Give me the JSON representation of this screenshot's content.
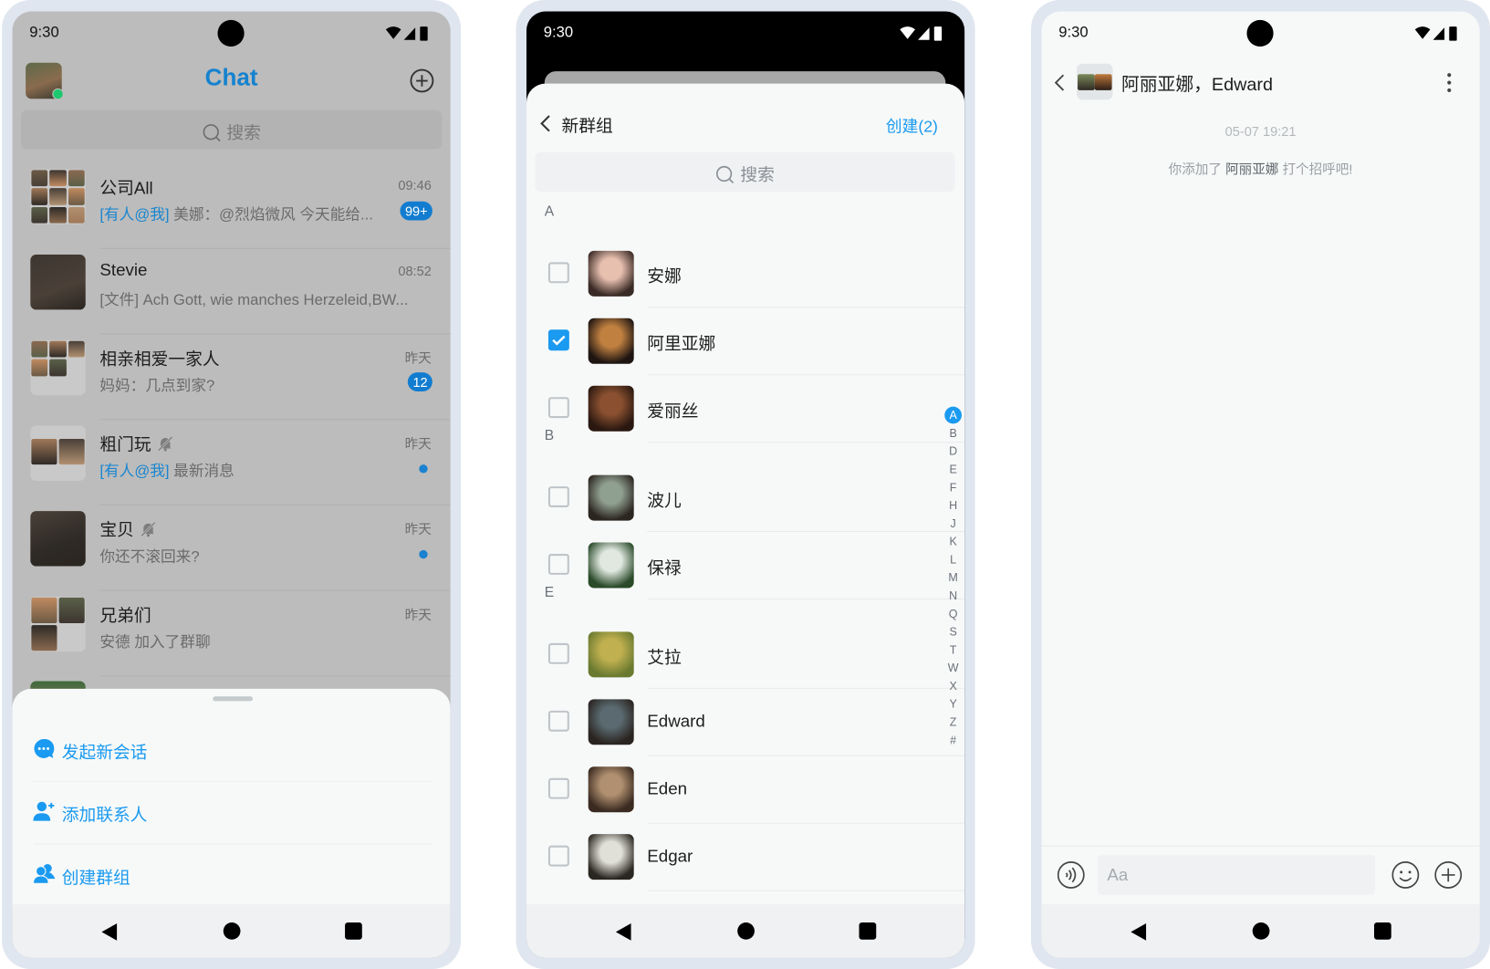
{
  "status_bar": {
    "time": "9:30"
  },
  "colors": {
    "accent": "#1a9af0",
    "title_blue": "#1582cf",
    "badge": "#127dd0",
    "online": "#1ec86e"
  },
  "chat_list": {
    "title": "Chat",
    "search_placeholder": "搜索",
    "rows": [
      {
        "name": "公司All",
        "time": "09:46",
        "mention": "[有人@我]",
        "preview": "美娜：@烈焰微风 今天能给...",
        "badge": "99+",
        "muted": false,
        "group": 9
      },
      {
        "name": "Stevie",
        "time": "08:52",
        "mention": "",
        "preview": "[文件] Ach Gott, wie manches Herzeleid,BW...",
        "badge": "",
        "muted": false,
        "group": 1
      },
      {
        "name": "相亲相爱一家人",
        "time": "昨天",
        "mention": "",
        "preview": "妈妈：几点到家?",
        "badge": "12",
        "muted": false,
        "group": 5
      },
      {
        "name": "粗门玩",
        "time": "昨天",
        "mention": "[有人@我]",
        "preview": "最新消息",
        "badge": "",
        "dot": true,
        "muted": true,
        "group": 2
      },
      {
        "name": "宝贝",
        "time": "昨天",
        "mention": "",
        "preview": "你还不滚回来?",
        "badge": "",
        "dot": true,
        "muted": true,
        "group": 1
      },
      {
        "name": "兄弟们",
        "time": "昨天",
        "mention": "",
        "preview": "安德 加入了群聊",
        "badge": "",
        "muted": false,
        "group": 3
      }
    ],
    "sheet_items": [
      {
        "label": "发起新会话",
        "icon": "chat-bubble-icon"
      },
      {
        "label": "添加联系人",
        "icon": "add-contact-icon"
      },
      {
        "label": "创建群组",
        "icon": "create-group-icon"
      }
    ]
  },
  "new_group": {
    "title": "新群组",
    "create_label": "创建(2)",
    "search_placeholder": "搜索",
    "sections": [
      {
        "letter": "A",
        "contacts": [
          {
            "name": "安娜",
            "checked": false
          },
          {
            "name": "阿里亚娜",
            "checked": true
          },
          {
            "name": "爱丽丝",
            "checked": false
          }
        ]
      },
      {
        "letter": "B",
        "contacts": [
          {
            "name": "波儿",
            "checked": false
          },
          {
            "name": "保禄",
            "checked": false
          }
        ]
      },
      {
        "letter": "E",
        "contacts": [
          {
            "name": "艾拉",
            "checked": false
          },
          {
            "name": "Edward",
            "checked": false
          },
          {
            "name": "Eden",
            "checked": false
          },
          {
            "name": "Edgar",
            "checked": false
          }
        ]
      }
    ],
    "index": [
      "A",
      "B",
      "D",
      "E",
      "F",
      "H",
      "J",
      "K",
      "L",
      "M",
      "N",
      "Q",
      "S",
      "T",
      "W",
      "X",
      "Y",
      "Z",
      "#"
    ],
    "index_active": "A"
  },
  "conversation": {
    "title": "阿丽亚娜，Edward",
    "timestamp": "05-07 19:21",
    "notice_prefix": "你添加了",
    "notice_name": "阿丽亚娜",
    "notice_suffix": "打个招呼吧!",
    "input_placeholder": "Aa"
  }
}
